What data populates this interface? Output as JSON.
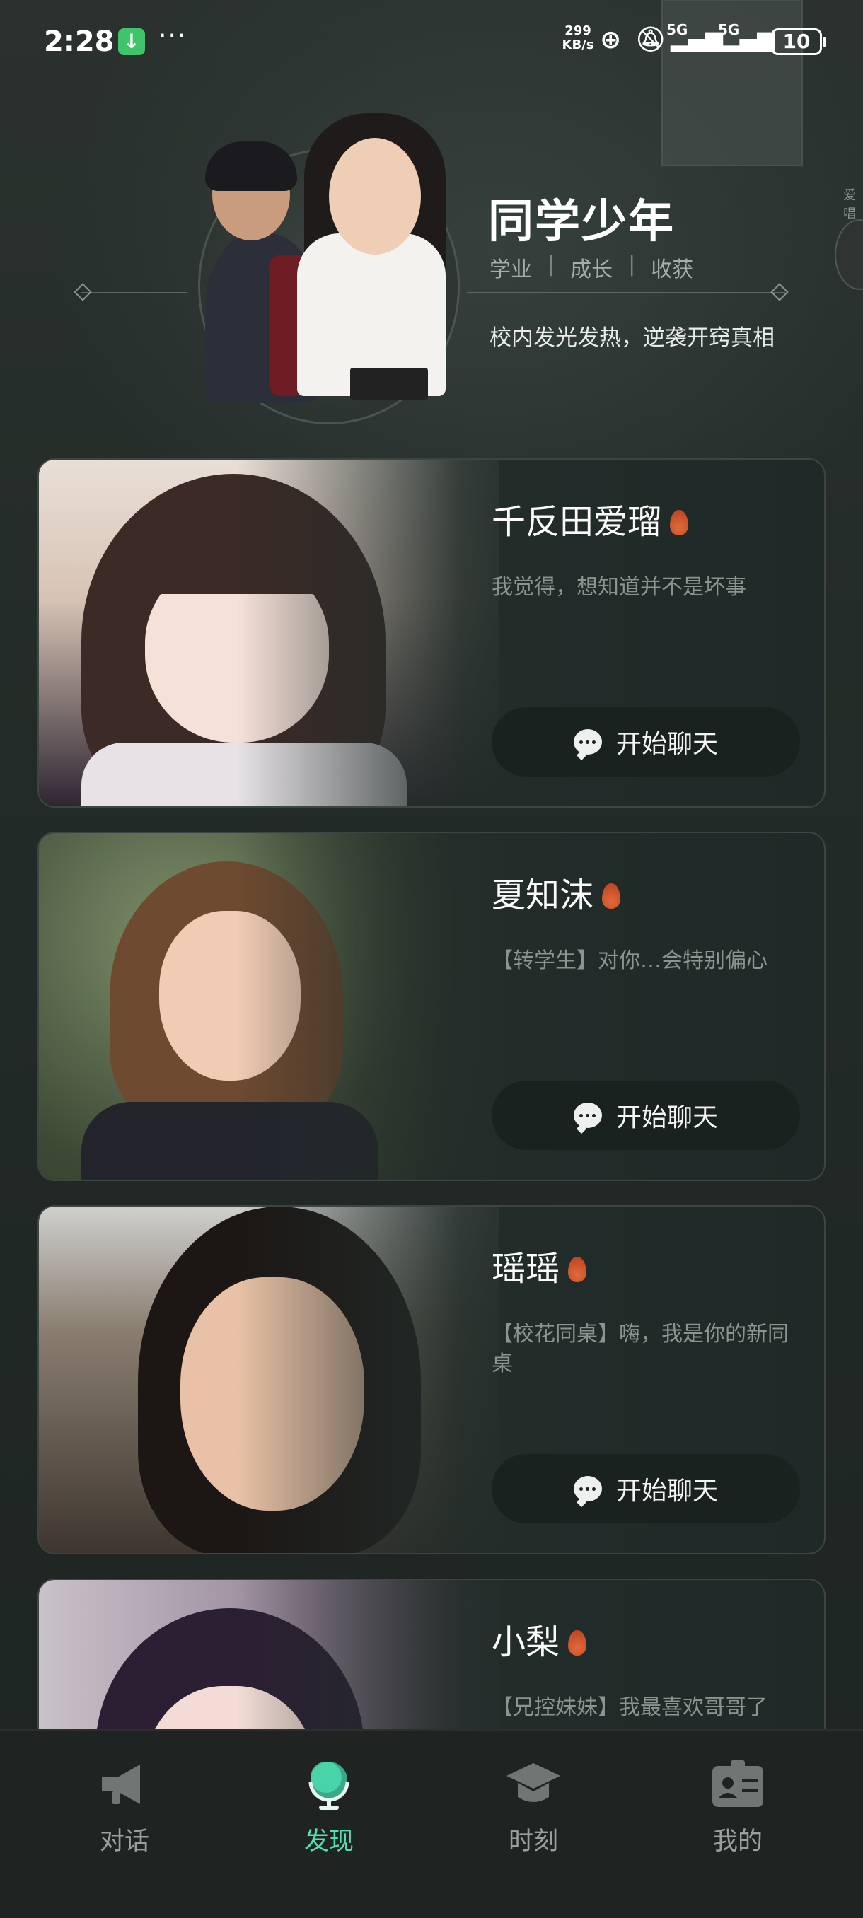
{
  "status_bar": {
    "time": "2:28",
    "more": "···",
    "net_speed_value": "299",
    "net_speed_unit": "KB/s",
    "signal_1": "5G",
    "signal_2": "5G",
    "battery": "10"
  },
  "hero": {
    "title": "同学少年",
    "tags": [
      "学业",
      "成长",
      "收获"
    ],
    "separator": "|",
    "description": "校内发光发热，逆袭开窍真相",
    "side_peek_text": "爱唱"
  },
  "cards": [
    {
      "name": "千反田爱瑠",
      "tagline": "我觉得，想知道并不是坏事",
      "button": "开始聊天"
    },
    {
      "name": "夏知沫",
      "tagline": "【转学生】对你…会特别偏心",
      "button": "开始聊天"
    },
    {
      "name": "瑶瑶",
      "tagline": "【校花同桌】嗨，我是你的新同桌",
      "button": "开始聊天"
    },
    {
      "name": "小梨",
      "tagline": "【兄控妹妹】我最喜欢哥哥了",
      "button": "开始聊天"
    }
  ],
  "nav": {
    "items": [
      {
        "label": "对话",
        "icon": "megaphone-icon"
      },
      {
        "label": "发现",
        "icon": "globe-icon"
      },
      {
        "label": "时刻",
        "icon": "graduation-cap-icon"
      },
      {
        "label": "我的",
        "icon": "id-card-icon"
      }
    ],
    "active_index": 1,
    "active_color": "#4fe2b3"
  }
}
